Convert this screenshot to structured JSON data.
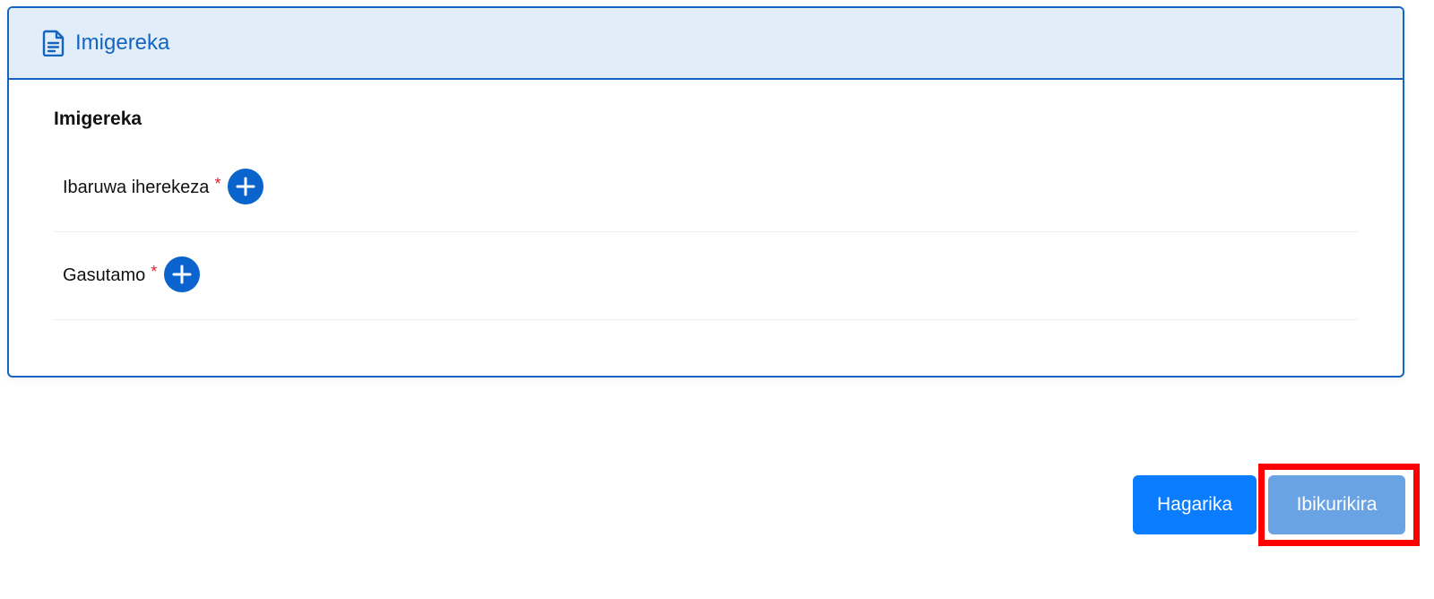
{
  "card": {
    "header_title": "Imigereka",
    "header_icon": "document-icon",
    "section_title": "Imigereka",
    "rows": [
      {
        "label": "Ibaruwa iherekeza",
        "required": "*",
        "action_icon": "plus-icon"
      },
      {
        "label": "Gasutamo",
        "required": "*",
        "action_icon": "plus-icon"
      }
    ]
  },
  "actions": {
    "cancel_label": "Hagarika",
    "next_label": "Ibikurikira"
  },
  "colors": {
    "accent": "#1565c0",
    "header_bg": "#e1edf9",
    "primary_button": "#0a7cff",
    "disabled_button": "#6aa3e4",
    "required": "#e0202a",
    "highlight": "#ff0000"
  }
}
